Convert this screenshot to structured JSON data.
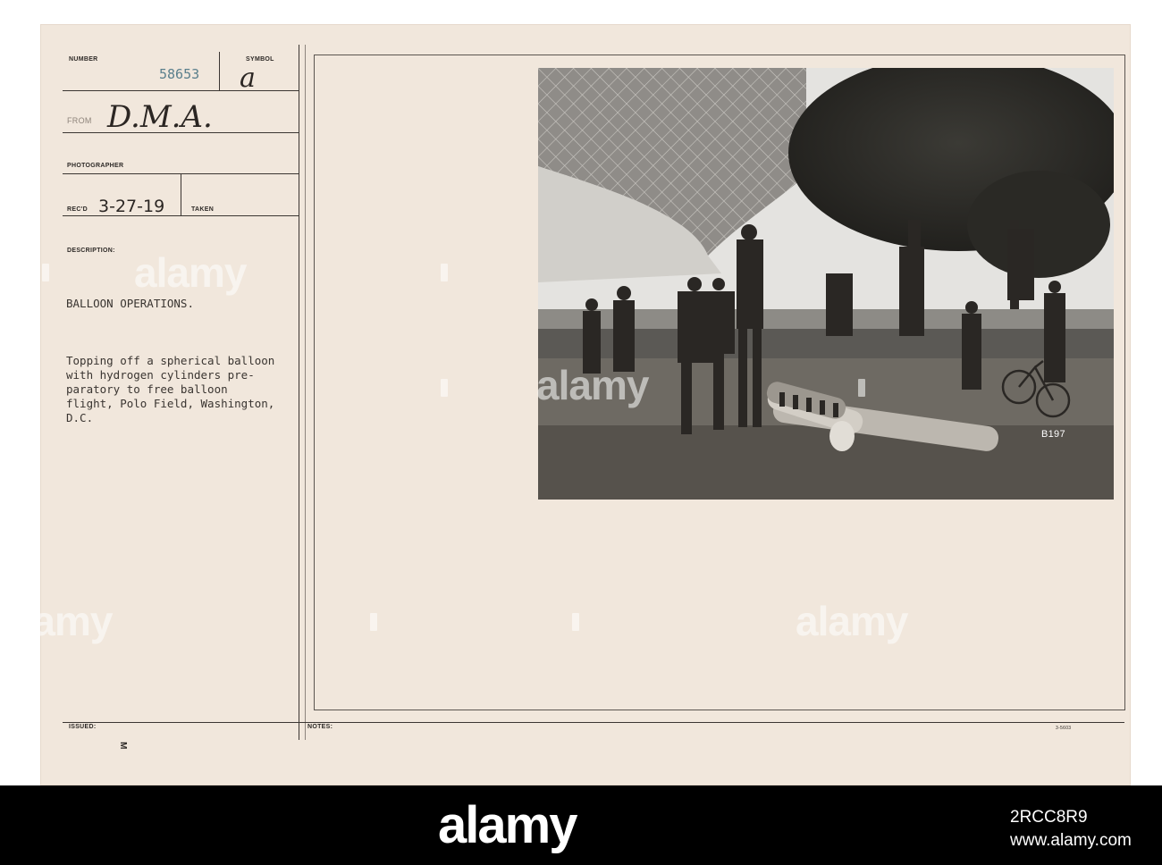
{
  "card": {
    "number_label": "NUMBER",
    "number_value": "58653",
    "symbol_label": "SYMBOL",
    "symbol_value": "a",
    "from_label": "FROM",
    "from_value": "D.M.A.",
    "photographer_label": "PHOTOGRAPHER",
    "recd_label": "REC'D",
    "recd_value": "3-27-19",
    "taken_label": "TAKEN",
    "description_label": "DESCRIPTION:",
    "title": "BALLOON OPERATIONS.",
    "description_lines": [
      "Topping off a spherical balloon",
      "with hydrogen cylinders pre-",
      "paratory to free balloon",
      "flight, Polo Field, Washington,",
      "D.C."
    ],
    "issued_label": "ISSUED:",
    "notes_label": "NOTES:",
    "issued_mark": "M",
    "form_code": "3-5603",
    "photo_code": "B197"
  },
  "watermark": {
    "text": "alamy"
  },
  "footer": {
    "logo": "alamy",
    "image_id": "2RCC8R9",
    "credit": "www.alamy.com"
  },
  "colors": {
    "card": "#f1e7dc",
    "ink": "#3a3531",
    "number_ink": "#5a7f8c",
    "footer": "#000000"
  }
}
